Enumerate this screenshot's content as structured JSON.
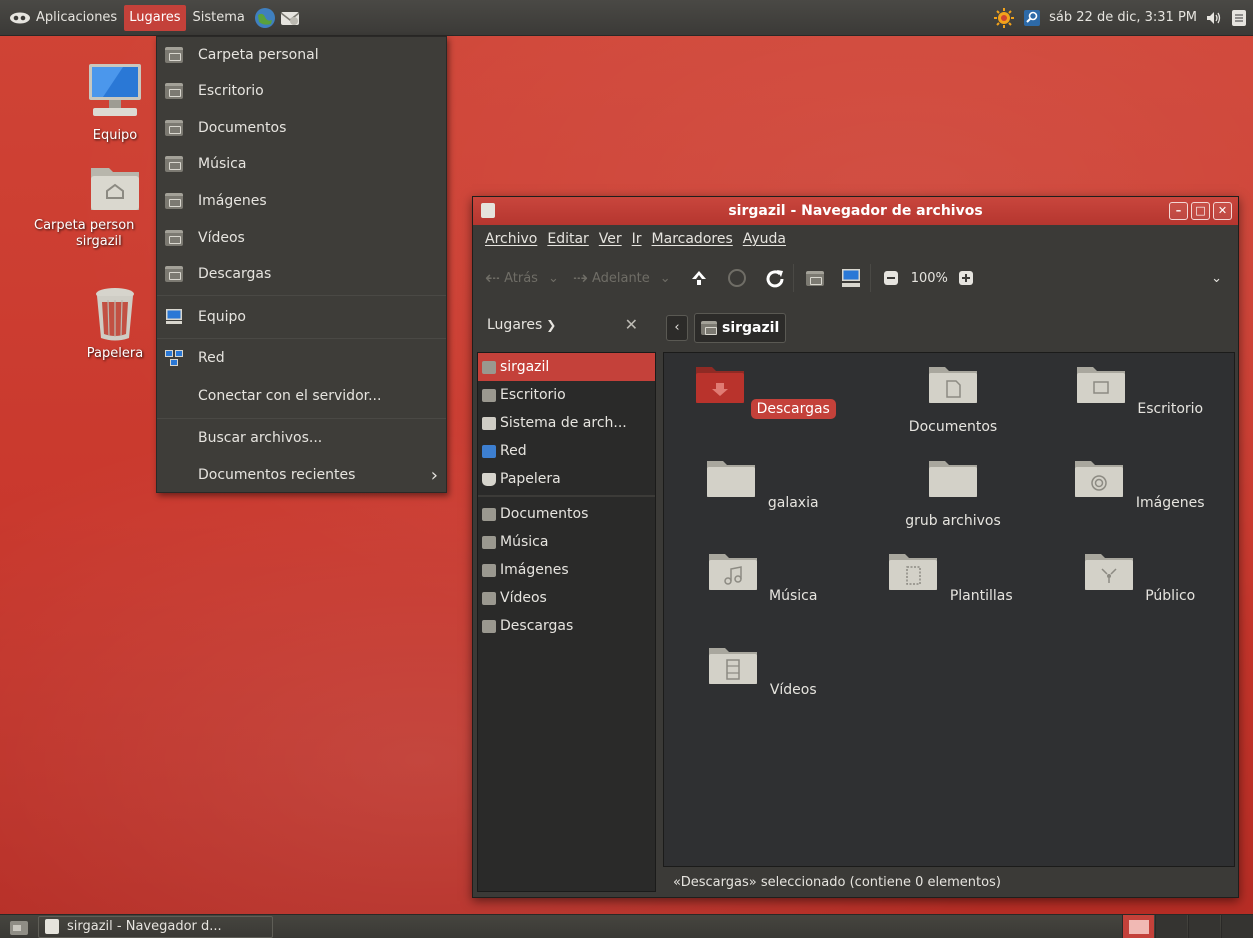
{
  "top_panel": {
    "menus": [
      "Aplicaciones",
      "Lugares",
      "Sistema"
    ],
    "active_menu": "Lugares",
    "clock": "sáb 22 de dic,  3:31 PM"
  },
  "places_menu": {
    "items": [
      {
        "label": "Carpeta personal",
        "icon": "home-folder-icon"
      },
      {
        "label": "Escritorio",
        "icon": "desktop-folder-icon"
      },
      {
        "label": "Documentos",
        "icon": "documents-folder-icon"
      },
      {
        "label": "Música",
        "icon": "music-folder-icon"
      },
      {
        "label": "Imágenes",
        "icon": "pictures-folder-icon"
      },
      {
        "label": "Vídeos",
        "icon": "videos-folder-icon"
      },
      {
        "label": "Descargas",
        "icon": "downloads-folder-icon"
      }
    ],
    "computer": "Equipo",
    "network": "Red",
    "connect": "Conectar con el servidor...",
    "search": "Buscar archivos...",
    "recent": "Documentos recientes"
  },
  "desktop_icons": [
    {
      "label": "Equipo",
      "icon": "computer-icon"
    },
    {
      "label": "Carpeta personal de sirgazil",
      "label_line1": "Carpeta person",
      "label_line2": "sirgazil",
      "icon": "home-folder-icon"
    },
    {
      "label": "Papelera",
      "icon": "trash-icon"
    }
  ],
  "window": {
    "title": "sirgazil - Navegador de archivos",
    "menubar": [
      "Archivo",
      "Editar",
      "Ver",
      "Ir",
      "Marcadores",
      "Ayuda"
    ],
    "toolbar": {
      "back": "Atrás",
      "forward": "Adelante",
      "zoom": "100%"
    },
    "sidebar_header": "Lugares",
    "path": "sirgazil",
    "sidebar_items": [
      {
        "label": "sirgazil",
        "selected": true
      },
      {
        "label": "Escritorio"
      },
      {
        "label": "Sistema de arch..."
      },
      {
        "label": "Red"
      },
      {
        "label": "Papelera"
      }
    ],
    "sidebar_bookmarks": [
      {
        "label": "Documentos"
      },
      {
        "label": "Música"
      },
      {
        "label": "Imágenes"
      },
      {
        "label": "Vídeos"
      },
      {
        "label": "Descargas"
      }
    ],
    "files": [
      {
        "name": "Descargas",
        "selected": true,
        "icon": "downloads-folder-icon"
      },
      {
        "name": "Documentos",
        "icon": "documents-folder-icon"
      },
      {
        "name": "Escritorio",
        "icon": "desktop-folder-icon"
      },
      {
        "name": "galaxia",
        "icon": "folder-icon"
      },
      {
        "name": "grub archivos",
        "icon": "folder-icon"
      },
      {
        "name": "Imágenes",
        "icon": "pictures-folder-icon"
      },
      {
        "name": "Música",
        "icon": "music-folder-icon"
      },
      {
        "name": "Plantillas",
        "icon": "templates-folder-icon"
      },
      {
        "name": "Público",
        "icon": "public-folder-icon"
      },
      {
        "name": "Vídeos",
        "icon": "videos-folder-icon"
      }
    ],
    "status": "«Descargas» seleccionado (contiene 0 elementos)"
  },
  "bottom_panel": {
    "task": "sirgazil - Navegador d..."
  },
  "colors": {
    "accent": "#c4413a",
    "panel": "#3b3a37",
    "desktop": "#c9392f"
  }
}
